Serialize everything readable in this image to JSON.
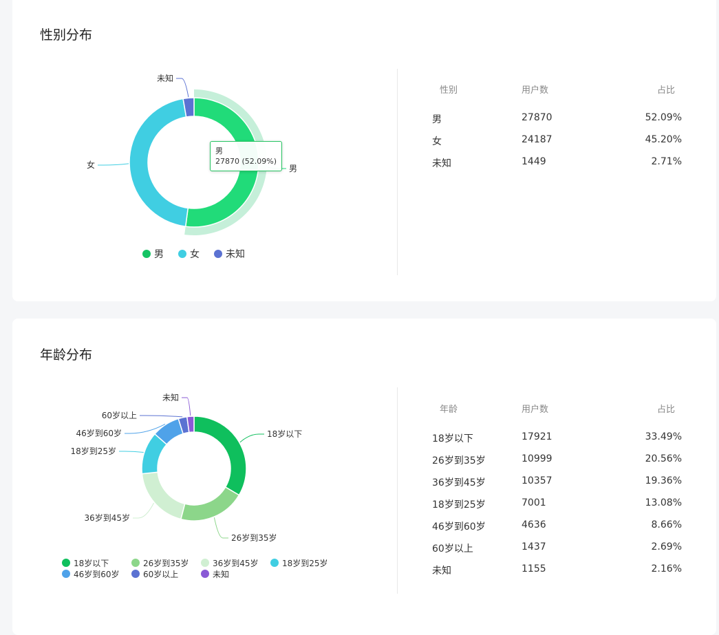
{
  "gender_section": {
    "title": "性别分布",
    "tooltip": {
      "name": "男",
      "text": "27870 (52.09%)"
    },
    "table": {
      "headers": [
        "性别",
        "用户数",
        "占比"
      ],
      "rows": [
        {
          "name": "男",
          "count": "27870",
          "pct": "52.09%"
        },
        {
          "name": "女",
          "count": "24187",
          "pct": "45.20%"
        },
        {
          "name": "未知",
          "count": "1449",
          "pct": "2.71%"
        }
      ]
    }
  },
  "age_section": {
    "title": "年龄分布",
    "table": {
      "headers": [
        "年龄",
        "用户数",
        "占比"
      ],
      "rows": [
        {
          "name": "18岁以下",
          "count": "17921",
          "pct": "33.49%"
        },
        {
          "name": "26岁到35岁",
          "count": "10999",
          "pct": "20.56%"
        },
        {
          "name": "36岁到45岁",
          "count": "10357",
          "pct": "19.36%"
        },
        {
          "name": "18岁到25岁",
          "count": "7001",
          "pct": "13.08%"
        },
        {
          "name": "46岁到60岁",
          "count": "4636",
          "pct": "8.66%"
        },
        {
          "name": "60岁以上",
          "count": "1437",
          "pct": "2.69%"
        },
        {
          "name": "未知",
          "count": "1155",
          "pct": "2.16%"
        }
      ]
    }
  },
  "chart_data": [
    {
      "type": "pie",
      "variant": "donut",
      "title": "性别分布",
      "categories": [
        "男",
        "女",
        "未知"
      ],
      "values": [
        27870,
        24187,
        1449
      ],
      "percentages": [
        52.09,
        45.2,
        2.71
      ],
      "colors": [
        "#21db79",
        "#40cee2",
        "#5b72d2"
      ],
      "legend_colors": [
        "#15c464",
        "#40cee2",
        "#5b72d2"
      ],
      "highlighted": "男",
      "highlight_ring_color": "#c5efd9",
      "legend_position": "bottom"
    },
    {
      "type": "pie",
      "variant": "donut",
      "title": "年龄分布",
      "categories": [
        "18岁以下",
        "26岁到35岁",
        "36岁到45岁",
        "18岁到25岁",
        "46岁到60岁",
        "60岁以上",
        "未知"
      ],
      "values": [
        17921,
        10999,
        10357,
        7001,
        4636,
        1437,
        1155
      ],
      "percentages": [
        33.49,
        20.56,
        19.36,
        13.08,
        8.66,
        2.69,
        2.16
      ],
      "colors": [
        "#0fbf5d",
        "#8cd68a",
        "#d0efd2",
        "#40cee2",
        "#4fa2e9",
        "#5b72d2",
        "#8a5ad6"
      ],
      "legend_position": "bottom"
    }
  ]
}
